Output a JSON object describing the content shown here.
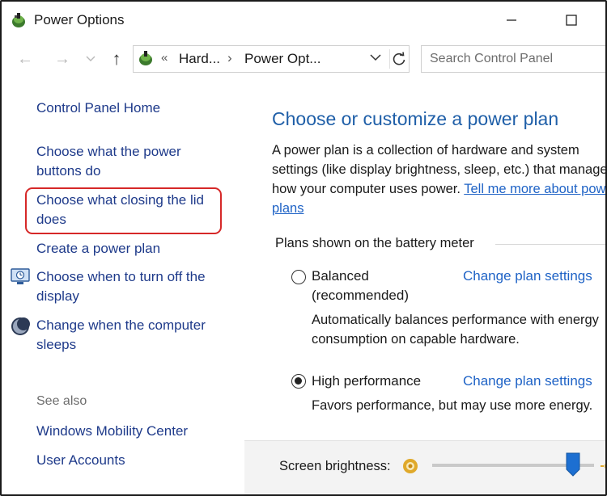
{
  "window": {
    "title": "Power Options"
  },
  "nav": {
    "crumbs": [
      "Hard...",
      "Power Opt..."
    ],
    "search_placeholder": "Search Control Panel"
  },
  "sidebar": {
    "home": "Control Panel Home",
    "items": [
      "Choose what the power buttons do",
      "Choose what closing the lid does",
      "Create a power plan",
      "Choose when to turn off the display",
      "Change when the computer sleeps"
    ],
    "see_also_label": "See also",
    "see_also": [
      "Windows Mobility Center",
      "User Accounts"
    ]
  },
  "main": {
    "heading": "Choose or customize a power plan",
    "desc_text": "A power plan is a collection of hardware and system settings (like display brightness, sleep, etc.) that manages how your computer uses power.",
    "desc_link": "Tell me more about power plans",
    "group_title": "Plans shown on the battery meter",
    "plans": [
      {
        "name": "Balanced (recommended)",
        "change": "Change plan settings",
        "description": "Automatically balances performance with energy consumption on capable hardware.",
        "selected": false
      },
      {
        "name": "High performance",
        "change": "Change plan settings",
        "description": "Favors performance, but may use more energy.",
        "selected": true
      }
    ]
  },
  "footer": {
    "brightness_label": "Screen brightness:",
    "brightness_level": 0.87
  },
  "colors": {
    "heading": "#1f5fa8",
    "link": "#1f63c6",
    "sidebar_link": "#1e3a8a",
    "highlight": "#d62828"
  }
}
